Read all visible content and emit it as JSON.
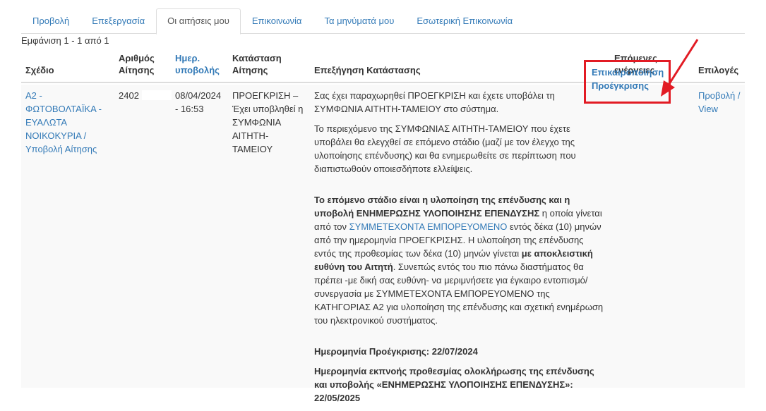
{
  "tabs": [
    {
      "label": "Προβολή",
      "active": false
    },
    {
      "label": "Επεξεργασία",
      "active": false
    },
    {
      "label": "Οι αιτήσεις μου",
      "active": true
    },
    {
      "label": "Επικοινωνία",
      "active": false
    },
    {
      "label": "Τα μηνύματά μου",
      "active": false
    },
    {
      "label": "Εσωτερική Επικοινωνία",
      "active": false
    }
  ],
  "summary": "Εμφάνιση 1 - 1 από 1",
  "headers": {
    "plan": "Σχέδιο",
    "app_number_1": "Αριθμός",
    "app_number_2": "Αίτησης",
    "submit_date_1": "Ημερ.",
    "submit_date_2": "υποβολής",
    "status_1": "Κατάσταση",
    "status_2": "Αίτησης",
    "status_explanation": "Επεξήγηση Κατάστασης",
    "next_actions_1": "Επόμενες",
    "next_actions_2": "ενέργειες",
    "options": "Επιλογές"
  },
  "row": {
    "plan_lines": [
      "Α2 -",
      "ΦΩΤΟΒΟΛΤΑΪΚΑ -",
      "ΕΥΑΛΩΤΑ",
      "ΝΟΙΚΟΚΥΡΙΑ /",
      "Υποβολή Αίτησης"
    ],
    "app_number": "2402",
    "submit_date_1": "08/04/2024",
    "submit_date_2": "- 16:53",
    "status_lines": [
      "ΠΡΟΕΓΚΡΙΣΗ –",
      "Έχει υποβληθεί η",
      "ΣΥΜΦΩΝΙΑ",
      "ΑΙΤΗΤΗ-",
      "ΤΑΜΕΙΟΥ"
    ],
    "desc": {
      "p1": "Σας έχει παραχωρηθεί ΠΡΟΕΓΚΡΙΣΗ και έχετε υποβάλει τη ΣΥΜΦΩΝΙΑ ΑΙΤΗΤΗ-ΤΑΜΕΙΟΥ στο σύστημα.",
      "p2": "Το περιεχόμενο της ΣΥΜΦΩΝΙΑΣ ΑΙΤΗΤΗ-ΤΑΜΕΙΟΥ που έχετε υποβάλει θα ελεγχθεί σε επόμενο στάδιο (μαζί με τον έλεγχο της υλοποίησης επένδυσης) και θα ενημερωθείτε σε περίπτωση που διαπιστωθούν οποιεσδήποτε ελλείψεις.",
      "p3_bold": "Το επόμενο στάδιο είναι η υλοποίηση της επένδυσης και η υποβολή ΕΝΗΜΕΡΩΣΗΣ ΥΛΟΠΟΙΗΣΗΣ ΕΠΕΝΔΥΣΗΣ",
      "p3_text1": " η οποία γίνεται από τον ",
      "p3_link": "ΣΥΜΜΕΤΕΧΟΝΤΑ ΕΜΠΟΡΕΥΟΜΕΝΟ",
      "p3_text2": " εντός δέκα (10) μηνών από την ημερομηνία ΠΡΟΕΓΚΡΙΣΗΣ. Η υλοποίηση της επένδυσης εντός της προθεσμίας των δέκα (10) μηνών γίνεται ",
      "p3_bold2": "με αποκλειστική ευθύνη του Αιτητή",
      "p3_text3": ". Συνεπώς εντός του πιο πάνω διαστήματος θα πρέπει -με δική σας ευθύνη- να μεριμνήσετε για έγκαιρο εντοπισμό/συνεργασία με ΣΥΜΜΕΤΕΧΟΝΤΑ ΕΜΠΟΡΕΥΟΜΕΝΟ της ΚΑΤΗΓΟΡΙΑΣ Α2 για υλοποίηση της επένδυσης και σχετική ενημέρωση του ηλεκτρονικού συστήματος.",
      "approval_date": "Ημερομηνία Προέγκρισης: 22/07/2024",
      "deadline": "Ημερομηνία εκπνοής προθεσμίας ολοκλήρωσης της επένδυσης και υποβολής «ΕΝΗΜΕΡΩΣΗΣ ΥΛΟΠΟΙΗΣΗΣ ΕΠΕΝΔΥΣΗΣ»: 22/05/2025"
    },
    "next_action_1": "Επικαιροποίηση",
    "next_action_2": "Προέγκρισης",
    "options_label_1": "Προβολή /",
    "options_label_2": "View"
  },
  "colors": {
    "link": "#337ab7",
    "highlight": "#e21b24",
    "row_bg": "#f9f9f9"
  }
}
